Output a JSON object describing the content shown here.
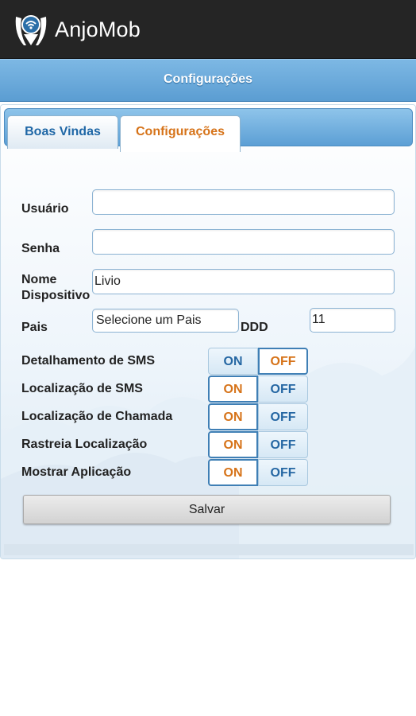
{
  "app": {
    "title": "AnjoMob"
  },
  "header": {
    "title": "Configurações"
  },
  "tabs": [
    {
      "label": "Boas Vindas",
      "active": false
    },
    {
      "label": "Configurações",
      "active": true
    }
  ],
  "form": {
    "usuario": {
      "label": "Usuário",
      "value": ""
    },
    "senha": {
      "label": "Senha",
      "value": ""
    },
    "nome_dispositivo": {
      "label_line1": "Nome",
      "label_line2": "Dispositivo",
      "value": "Livio"
    },
    "pais": {
      "label": "Pais",
      "value": "Selecione um Pais"
    },
    "ddd": {
      "label": "DDD",
      "value": "11"
    }
  },
  "toggles": [
    {
      "label": "Detalhamento de SMS",
      "on": "ON",
      "off": "OFF",
      "selected": "OFF"
    },
    {
      "label": "Localização de SMS",
      "on": "ON",
      "off": "OFF",
      "selected": "ON"
    },
    {
      "label": "Localização de Chamada",
      "on": "ON",
      "off": "OFF",
      "selected": "ON"
    },
    {
      "label": "Rastreia Localização",
      "on": "ON",
      "off": "OFF",
      "selected": "ON"
    },
    {
      "label": "Mostrar Aplicação",
      "on": "ON",
      "off": "OFF",
      "selected": "ON"
    }
  ],
  "save_button": {
    "label": "Salvar"
  },
  "colors": {
    "accent_orange": "#d67319",
    "accent_blue": "#1f67a6",
    "header_blue": "#6aa9db"
  }
}
